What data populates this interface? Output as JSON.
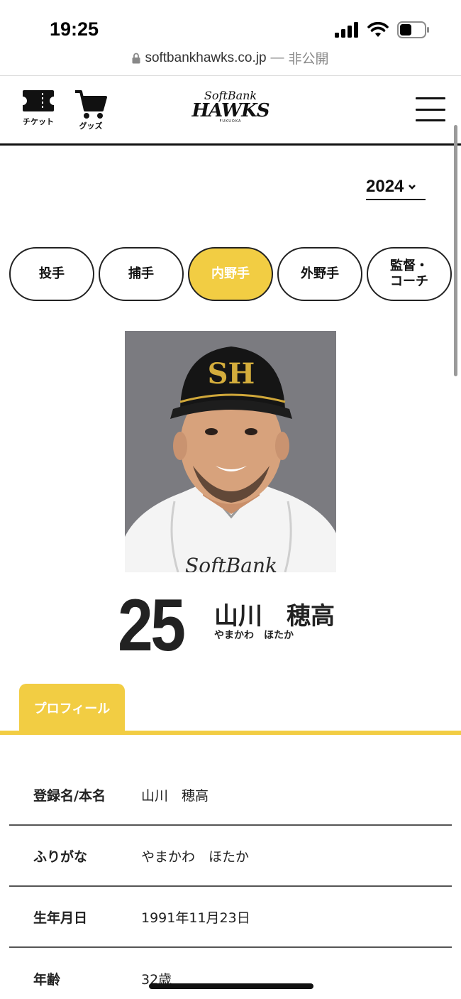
{
  "status_bar": {
    "time": "19:25"
  },
  "browser": {
    "url": "softbankhawks.co.jp",
    "separator": " — ",
    "private_label": "非公開"
  },
  "header": {
    "ticket_label": "チケット",
    "goods_label": "グッズ",
    "logo_top": "SoftBank",
    "logo_main": "HAWKS",
    "logo_sub": "FUKUOKA"
  },
  "year_select": {
    "value": "2024"
  },
  "position_tabs": [
    {
      "label": "投手",
      "active": false
    },
    {
      "label": "捕手",
      "active": false
    },
    {
      "label": "内野手",
      "active": true
    },
    {
      "label": "外野手",
      "active": false
    },
    {
      "label": "監督・\nコーチ",
      "active": false
    }
  ],
  "player": {
    "number": "25",
    "name": "山川　穂高",
    "kana": "やまかわ　ほたか"
  },
  "profile": {
    "tab_label": "プロフィール",
    "rows": [
      {
        "label": "登録名/本名",
        "value": "山川　穂高"
      },
      {
        "label": "ふりがな",
        "value": "やまかわ　ほたか"
      },
      {
        "label": "生年月日",
        "value": "1991年11月23日"
      },
      {
        "label": "年齢",
        "value": "32歳"
      }
    ]
  },
  "colors": {
    "accent": "#f2cd43",
    "text": "#222222"
  }
}
